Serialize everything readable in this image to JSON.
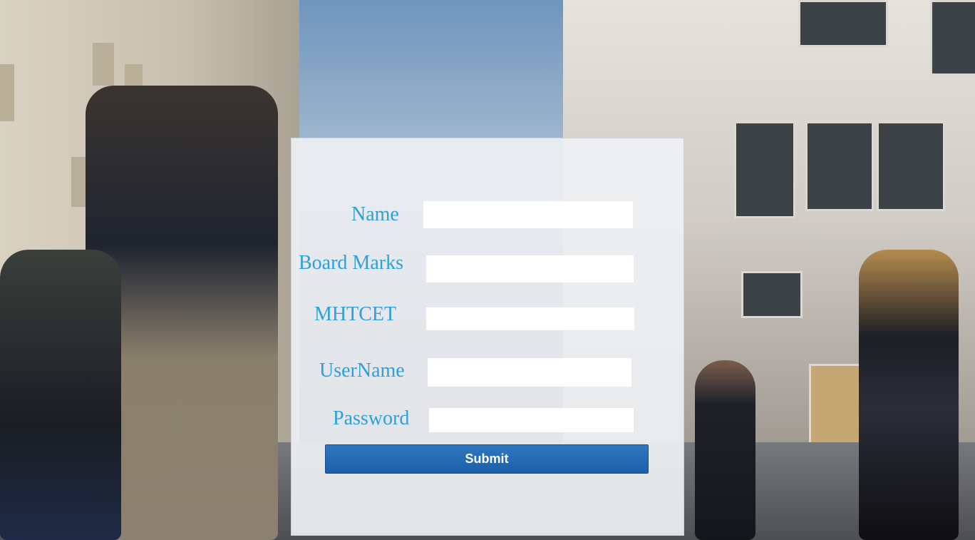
{
  "form": {
    "fields": [
      {
        "label": "Name",
        "value": "",
        "placeholder": ""
      },
      {
        "label": "Board Marks",
        "value": "",
        "placeholder": ""
      },
      {
        "label": "MHTCET",
        "value": "",
        "placeholder": ""
      },
      {
        "label": "UserName",
        "value": "",
        "placeholder": ""
      },
      {
        "label": "Password",
        "value": "",
        "placeholder": ""
      }
    ],
    "submit_label": "Submit"
  },
  "colors": {
    "label": "#2f9fd9",
    "button": "#1c5fa8",
    "panel": "#eef0f3"
  }
}
